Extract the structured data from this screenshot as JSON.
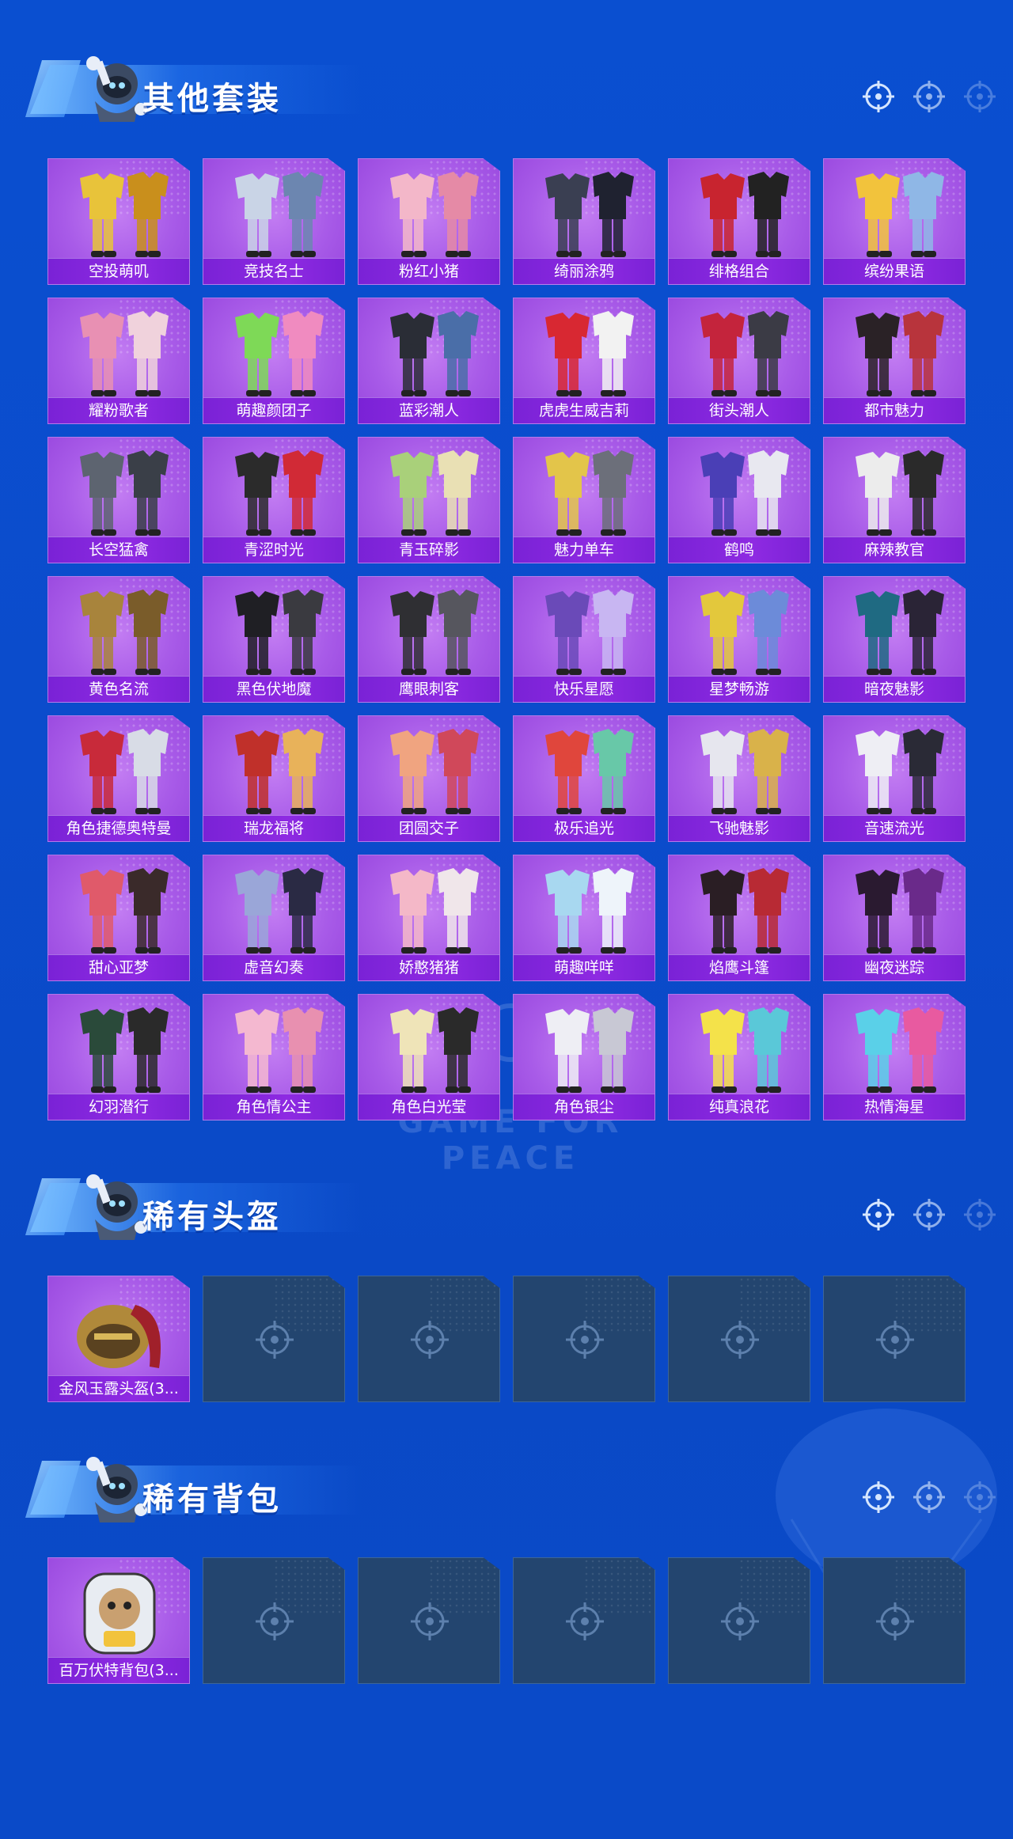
{
  "sections": [
    {
      "title": "其他套装",
      "items": [
        {
          "label": "空投萌叽"
        },
        {
          "label": "竞技名士"
        },
        {
          "label": "粉红小猪"
        },
        {
          "label": "绮丽涂鸦"
        },
        {
          "label": "绯格组合"
        },
        {
          "label": "缤纷果语"
        },
        {
          "label": "耀粉歌者"
        },
        {
          "label": "萌趣颜团子"
        },
        {
          "label": "蓝彩潮人"
        },
        {
          "label": "虎虎生威吉莉"
        },
        {
          "label": "街头潮人"
        },
        {
          "label": "都市魅力"
        },
        {
          "label": "长空猛禽"
        },
        {
          "label": "青涩时光"
        },
        {
          "label": "青玉碎影"
        },
        {
          "label": "魅力单车"
        },
        {
          "label": "鹤鸣"
        },
        {
          "label": "麻辣教官"
        },
        {
          "label": "黄色名流"
        },
        {
          "label": "黑色伏地魔"
        },
        {
          "label": "鹰眼刺客"
        },
        {
          "label": "快乐星愿"
        },
        {
          "label": "星梦畅游"
        },
        {
          "label": "暗夜魅影"
        },
        {
          "label": "角色捷德奥特曼"
        },
        {
          "label": "瑞龙福将"
        },
        {
          "label": "团圆交子"
        },
        {
          "label": "极乐追光"
        },
        {
          "label": "飞驰魅影"
        },
        {
          "label": "音速流光"
        },
        {
          "label": "甜心亚梦"
        },
        {
          "label": "虚音幻奏"
        },
        {
          "label": "娇憨猪猪"
        },
        {
          "label": "萌趣咩咩"
        },
        {
          "label": "焰鹰斗篷"
        },
        {
          "label": "幽夜迷踪"
        },
        {
          "label": "幻羽潜行"
        },
        {
          "label": "角色情公主"
        },
        {
          "label": "角色白光莹"
        },
        {
          "label": "角色银尘"
        },
        {
          "label": "纯真浪花"
        },
        {
          "label": "热情海星"
        }
      ],
      "empty_slots": 0
    },
    {
      "title": "稀有头盔",
      "items": [
        {
          "label": "金风玉露头盔(3..."
        }
      ],
      "empty_slots": 5
    },
    {
      "title": "稀有背包",
      "items": [
        {
          "label": "百万伏特背包(3..."
        }
      ],
      "empty_slots": 5
    }
  ],
  "watermark": "GAME FOR PEACE",
  "colors": {
    "background": "#0a4fd0",
    "card": "#a85be8",
    "label_bar": "#8e2ae2",
    "empty_slot": "#23456f"
  }
}
